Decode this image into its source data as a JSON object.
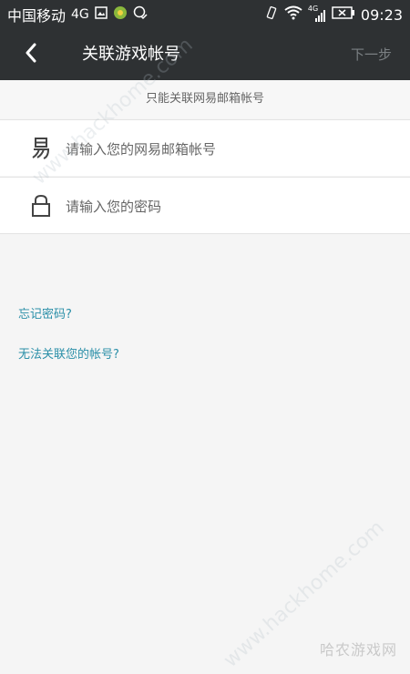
{
  "status_bar": {
    "carrier": "中国移动",
    "network": "4G",
    "signal_label": "4G",
    "time": "09:23"
  },
  "header": {
    "title": "关联游戏帐号",
    "next_label": "下一步",
    "back_icon": "chevron-left-icon"
  },
  "notice": "只能关联网易邮箱帐号",
  "form": {
    "email": {
      "placeholder": "请输入您的网易邮箱帐号",
      "value": "",
      "icon": "email-glyph-icon"
    },
    "password": {
      "placeholder": "请输入您的密码",
      "value": "",
      "icon": "lock-icon"
    }
  },
  "links": {
    "forgot_password": "忘记密码?",
    "cannot_link": "无法关联您的帐号?"
  },
  "watermark": {
    "text": "哈农游戏网",
    "diagonal_text": "www.hackhome.com"
  },
  "colors": {
    "header_bg": "#2e3133",
    "link": "#2a8fa8",
    "page_bg": "#f5f5f5"
  }
}
